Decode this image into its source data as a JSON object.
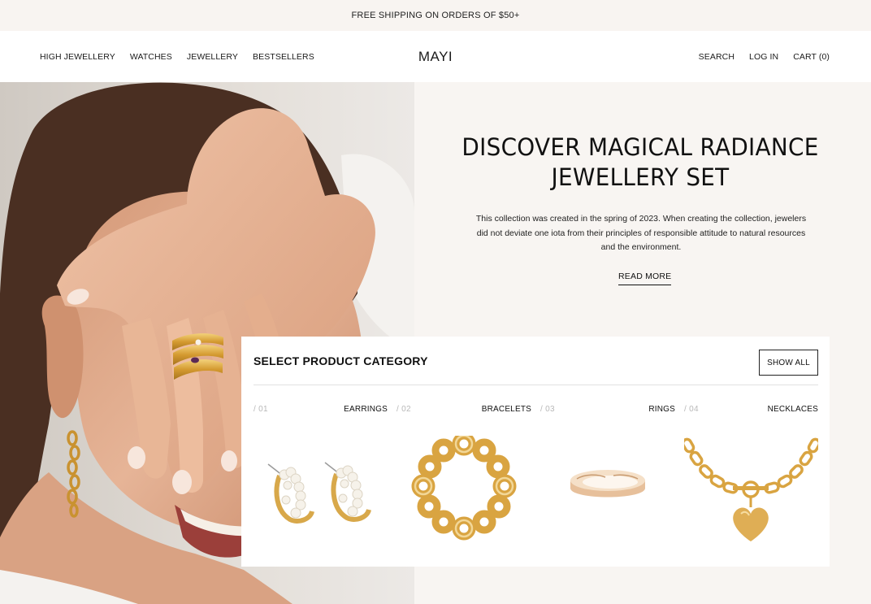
{
  "announcement": "FREE SHIPPING ON ORDERS OF $50+",
  "header": {
    "logo": "MAYI",
    "nav_left": [
      "HIGH JEWELLERY",
      "WATCHES",
      "JEWELLERY",
      "BESTSELLERS"
    ],
    "search": "SEARCH",
    "login": "LOG IN",
    "cart": "CART (0)"
  },
  "hero": {
    "title_line1": "DISCOVER MAGICAL RADIANCE",
    "title_line2": "JEWELLERY SET",
    "description": "This collection was created in the spring of 2023. When creating the collection, jewelers did not deviate one iota from their principles of responsible attitude to natural resources and the environment.",
    "read_more": "READ MORE"
  },
  "categories": {
    "title": "SELECT PRODUCT CATEGORY",
    "show_all": "SHOW ALL",
    "items": [
      {
        "num": "/ 01",
        "label": "EARRINGS",
        "icon": "pearl-earrings-image"
      },
      {
        "num": "/ 02",
        "label": "BRACELETS",
        "icon": "chain-bracelet-image"
      },
      {
        "num": "/ 03",
        "label": "RINGS",
        "icon": "gold-ring-image"
      },
      {
        "num": "/ 04",
        "label": "NECKLACES",
        "icon": "heart-necklace-image"
      }
    ]
  },
  "colors": {
    "announcement_bg": "#f8f4f1",
    "panel_bg": "#f8f5f2",
    "gold": "#d9a441",
    "text": "#111111"
  }
}
